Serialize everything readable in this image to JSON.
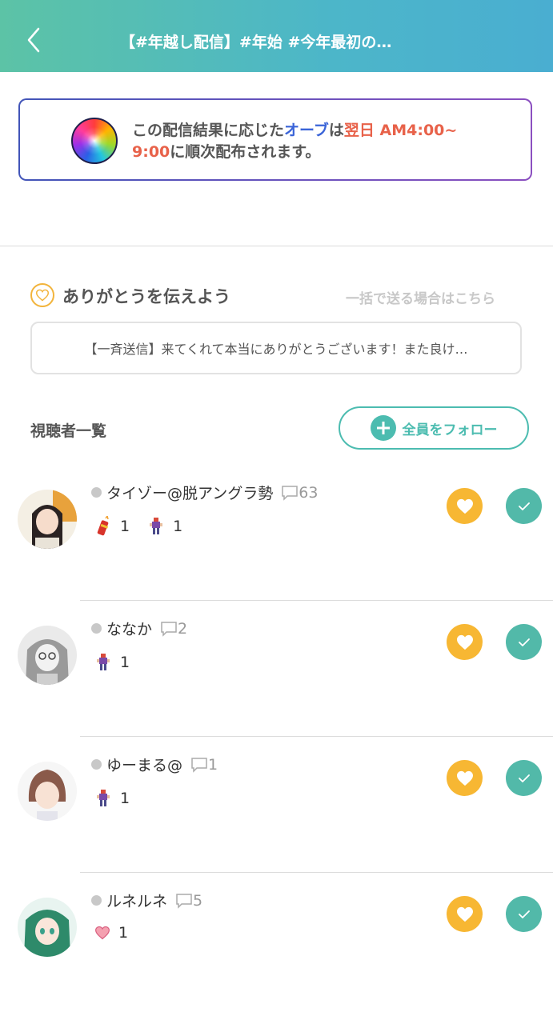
{
  "header": {
    "title": "【#年越し配信】#年始 #今年最初の…"
  },
  "notice": {
    "part1": "この配信結果に応じた",
    "orb_word": "オーブ",
    "part2": "は",
    "time_a": "翌日 AM4:00~",
    "time_b": "9:00",
    "part3": "に順次配布されます。"
  },
  "thanks": {
    "title": "ありがとうを伝えよう",
    "bulk_link": "一括で送る場合はこちら",
    "message": "【一斉送信】来てくれて本当にありがとうございます！また良け…"
  },
  "viewers": {
    "title": "視聴者一覧",
    "follow_all": "全員をフォロー",
    "items": [
      {
        "name": "タイゾー@脱アングラ勢",
        "comments": "63",
        "gifts": [
          {
            "icon": "firework-icon",
            "count": "1"
          },
          {
            "icon": "pixel-character-icon",
            "count": "1"
          }
        ]
      },
      {
        "name": "ななか",
        "comments": "2",
        "gifts": [
          {
            "icon": "pixel-character-icon",
            "count": "1"
          }
        ]
      },
      {
        "name": "ゆーまる@",
        "comments": "1",
        "gifts": [
          {
            "icon": "pixel-character-icon",
            "count": "1"
          }
        ]
      },
      {
        "name": "ルネルネ",
        "comments": "5",
        "gifts": [
          {
            "icon": "heart-gift-icon",
            "count": "1"
          }
        ]
      }
    ]
  },
  "colors": {
    "header_start": "#5cc3a6",
    "header_end": "#4aaed1",
    "accent_teal": "#52b9a9",
    "heart_yellow": "#f7b733",
    "highlight_blue": "#3a64d8",
    "highlight_red": "#e8624a"
  }
}
